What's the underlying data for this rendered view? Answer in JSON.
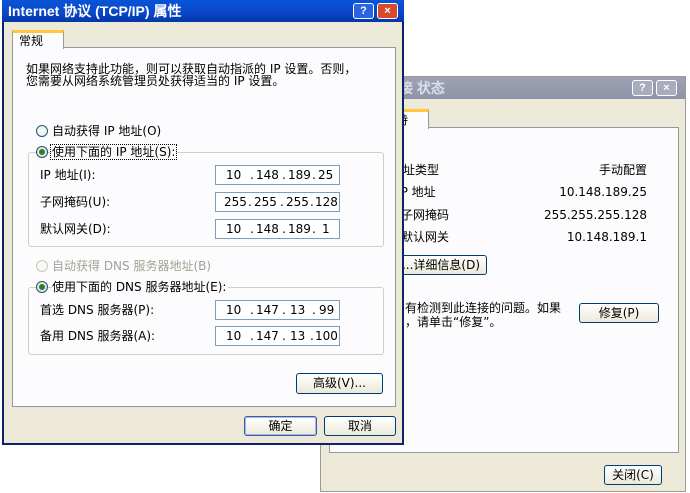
{
  "status_window": {
    "title": "本地连接 状态",
    "title_visible": "接 状态",
    "tab_label": "支持",
    "tab_visible": "持",
    "rows": [
      {
        "label": "地址类型:",
        "value": "手动配置"
      },
      {
        "label": "IP 地址:",
        "value": "10.148.189.25"
      },
      {
        "label": "子网掩码:",
        "value": "255.255.255.128"
      },
      {
        "label": "默认网关:",
        "value": "10.148.189.1"
      }
    ],
    "details_button": "详细信息(D)...",
    "repair_text_line1": "有检测到此连接的问题。如果",
    "repair_text_line2": "，请单击“修复”。",
    "repair_button": "修复(P)",
    "close_button": "关闭(C)"
  },
  "tcpip_window": {
    "title": "Internet 协议 (TCP/IP) 属性",
    "help_button": "?",
    "close_icon": "×",
    "tab_label": "常规",
    "intro_line1": "如果网络支持此功能，则可以获取自动指派的 IP 设置。否则，",
    "intro_line2": "您需要从网络系统管理员处获得适当的 IP 设置。",
    "radio_auto_ip": "自动获得 IP 地址(O)",
    "radio_manual_ip": "使用下面的 IP 地址(S):",
    "ip_label": "IP 地址(I):",
    "ip_value": [
      "10",
      "148",
      "189",
      "25"
    ],
    "mask_label": "子网掩码(U):",
    "mask_value": [
      "255",
      "255",
      "255",
      "128"
    ],
    "gateway_label": "默认网关(D):",
    "gateway_value": [
      "10",
      "148",
      "189",
      "1"
    ],
    "radio_auto_dns": "自动获得 DNS 服务器地址(B)",
    "radio_manual_dns": "使用下面的 DNS 服务器地址(E):",
    "dns1_label": "首选 DNS 服务器(P):",
    "dns1_value": [
      "10",
      "147",
      "13",
      "99"
    ],
    "dns2_label": "备用 DNS 服务器(A):",
    "dns2_value": [
      "10",
      "147",
      "13",
      "100"
    ],
    "advanced_button": "高级(V)...",
    "ok_button": "确定",
    "cancel_button": "取消"
  },
  "colors": {
    "active_title": "#0a46c8",
    "inactive_title": "#8e93a7",
    "dialog_bg": "#ece9d8",
    "tab_accent": "#ffc83c"
  }
}
